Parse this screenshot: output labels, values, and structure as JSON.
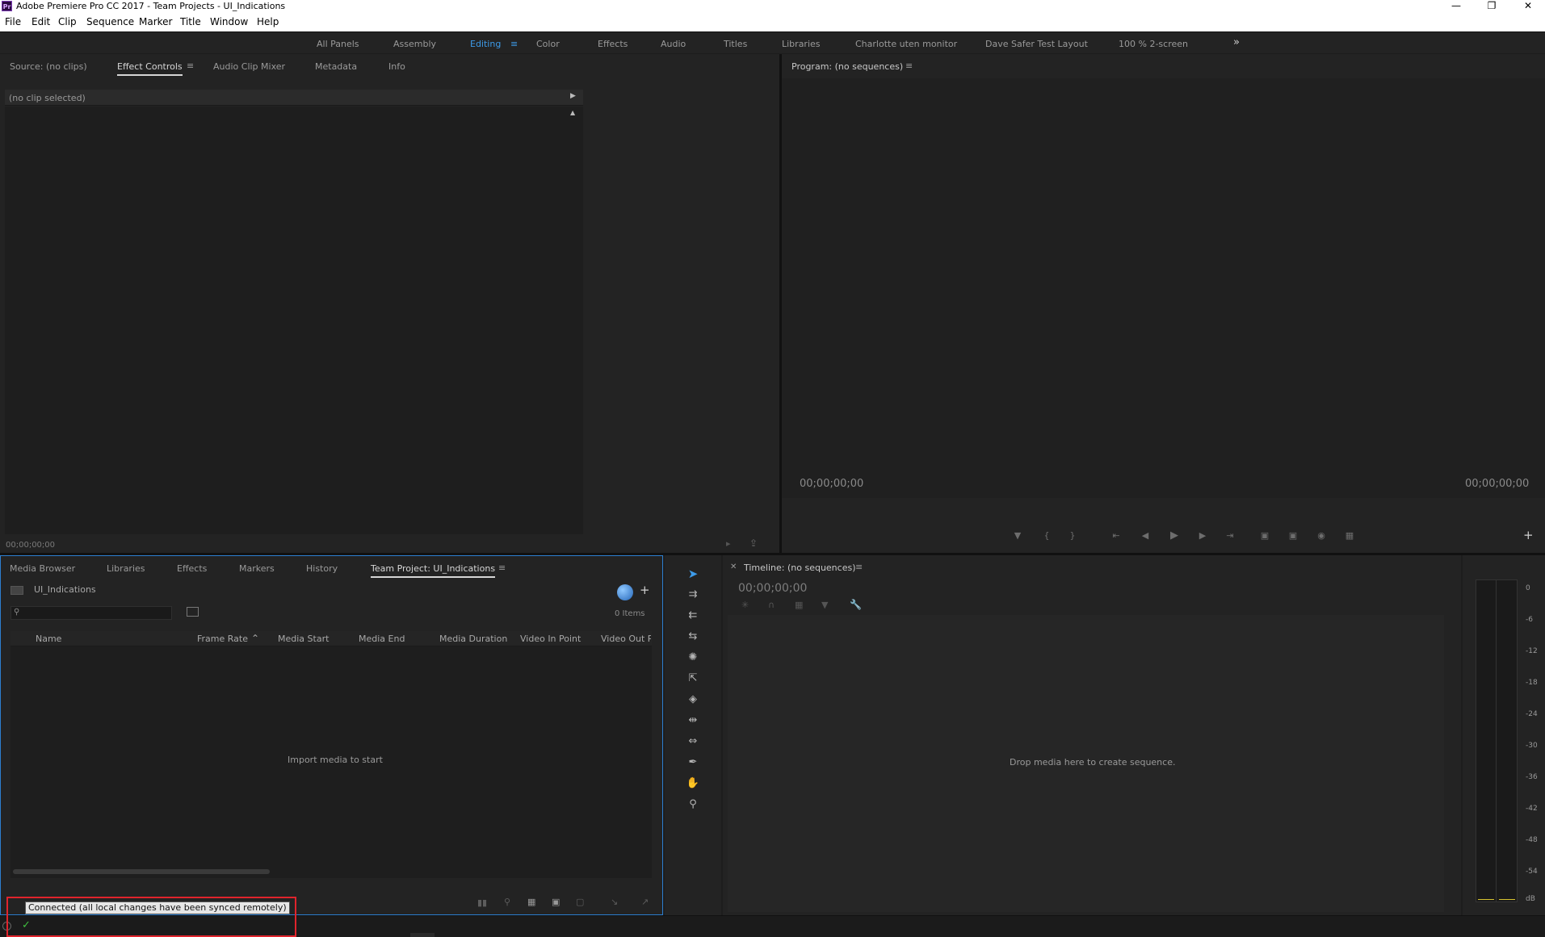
{
  "window": {
    "title": "Adobe Premiere Pro CC 2017 - Team Projects - UI_Indications",
    "app_icon_text": "Pr"
  },
  "menu": [
    "File",
    "Edit",
    "Clip",
    "Sequence",
    "Marker",
    "Title",
    "Window",
    "Help"
  ],
  "workspaces": {
    "items": [
      "All Panels",
      "Assembly",
      "Editing",
      "Color",
      "Effects",
      "Audio",
      "Titles",
      "Libraries",
      "Charlotte uten monitor",
      "Dave Safer Test Layout",
      "100 % 2-screen"
    ],
    "active": "Editing",
    "overflow": "»"
  },
  "source_panel": {
    "tabs": [
      "Source: (no clips)",
      "Effect Controls",
      "Audio Clip Mixer",
      "Metadata",
      "Info"
    ],
    "active_tab": "Effect Controls",
    "no_clip": "(no clip selected)",
    "timecode": "00;00;00;00"
  },
  "program_panel": {
    "title": "Program: (no sequences)",
    "timecode_left": "00;00;00;00",
    "timecode_right": "00;00;00;00"
  },
  "project_panel": {
    "tabs": [
      "Media Browser",
      "Libraries",
      "Effects",
      "Markers",
      "History",
      "Team Project: UI_Indications"
    ],
    "active_tab": "Team Project: UI_Indications",
    "project_name": "UI_Indications",
    "items_count": "0 Items",
    "columns": [
      "Name",
      "Frame Rate",
      "Media Start",
      "Media End",
      "Media Duration",
      "Video In Point",
      "Video Out Po"
    ],
    "empty_message": "Import media to start"
  },
  "timeline_panel": {
    "title": "Timeline: (no sequences)",
    "timecode": "00;00;00;00",
    "drop_message": "Drop media here to create sequence."
  },
  "audio_meter": {
    "labels": [
      "0",
      "-6",
      "-12",
      "-18",
      "-24",
      "-30",
      "-36",
      "-42",
      "-48",
      "-54",
      "dB"
    ]
  },
  "status": {
    "tooltip": "Connected (all local changes have been synced remotely)"
  },
  "colors": {
    "accent": "#3d9be9",
    "highlight_box": "#e0242c",
    "sync_ok": "#3fbf3f"
  }
}
